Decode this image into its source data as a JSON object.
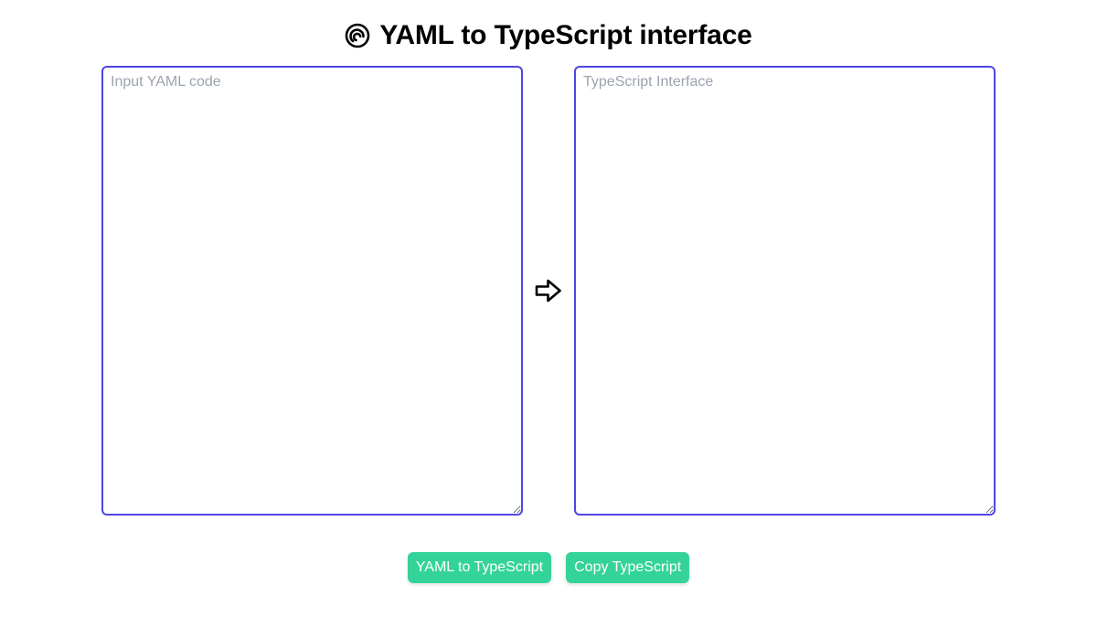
{
  "header": {
    "title": "YAML to TypeScript interface",
    "logo_icon": "spiral-logo-icon"
  },
  "input": {
    "placeholder": "Input YAML code",
    "value": ""
  },
  "output": {
    "placeholder": "TypeScript Interface",
    "value": ""
  },
  "arrow_icon": "arrow-right-outline-icon",
  "buttons": {
    "convert_label": "YAML to TypeScript",
    "copy_label": "Copy TypeScript"
  },
  "colors": {
    "panel_border": "#4f46e5",
    "button_bg": "#34d399",
    "placeholder": "#9ca3af"
  }
}
